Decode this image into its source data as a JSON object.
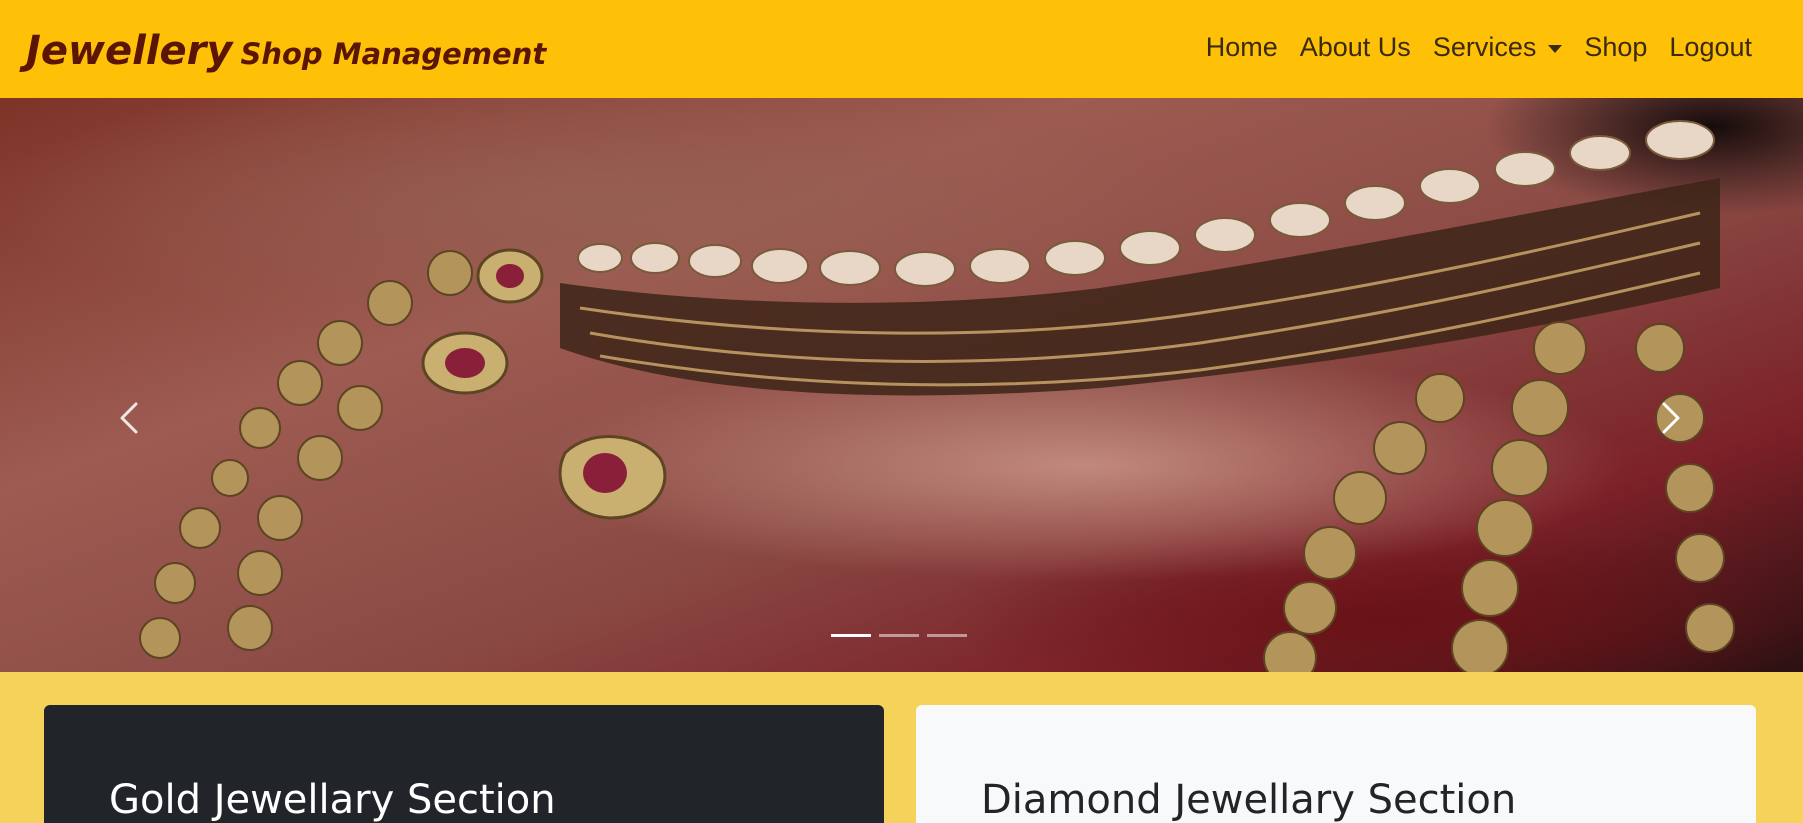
{
  "brand": {
    "main": "Jewellery",
    "sub": "Shop Management",
    "color": "#5a1505"
  },
  "nav": {
    "items": [
      {
        "label": "Home"
      },
      {
        "label": "About Us"
      },
      {
        "label": "Services",
        "dropdown": true
      },
      {
        "label": "Shop"
      },
      {
        "label": "Logout"
      }
    ]
  },
  "colors": {
    "navbar": "#ffc107",
    "page_background": "#f5d35a",
    "dark_card": "#212529",
    "light_card": "#f8f9fa"
  },
  "carousel": {
    "image": "jewellery necklace on maroon background",
    "controls": {
      "prev_icon": "chevron-left-icon",
      "next_icon": "chevron-right-icon"
    },
    "slide_count": 3,
    "active_slide": 1
  },
  "sections": [
    {
      "title": "Gold Jewellary Section"
    },
    {
      "title": "Diamond Jewellary Section"
    }
  ]
}
